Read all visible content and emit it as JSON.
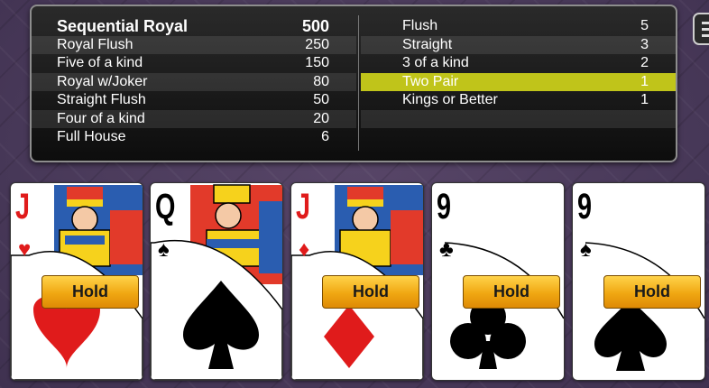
{
  "paytable": {
    "left": [
      {
        "name": "Sequential Royal",
        "pay": "500",
        "header": true
      },
      {
        "name": "Royal Flush",
        "pay": "250"
      },
      {
        "name": "Five of a kind",
        "pay": "150"
      },
      {
        "name": "Royal w/Joker",
        "pay": "80"
      },
      {
        "name": "Straight Flush",
        "pay": "50"
      },
      {
        "name": "Four of a kind",
        "pay": "20"
      },
      {
        "name": "Full House",
        "pay": "6"
      }
    ],
    "right": [
      {
        "name": "Flush",
        "pay": "5"
      },
      {
        "name": "Straight",
        "pay": "3"
      },
      {
        "name": "3 of a kind",
        "pay": "2"
      },
      {
        "name": "Two Pair",
        "pay": "1",
        "highlight": true
      },
      {
        "name": "Kings or Better",
        "pay": "1"
      }
    ],
    "highlight_color": "#c0c41a"
  },
  "menu_button": {
    "icon": "hamburger-menu-icon"
  },
  "cards": [
    {
      "rank": "J",
      "suit": "hearts",
      "suit_glyph": "♥",
      "color": "red",
      "face": true,
      "hold_label": "Hold",
      "held": true
    },
    {
      "rank": "Q",
      "suit": "spades",
      "suit_glyph": "♠",
      "color": "black",
      "face": true,
      "hold_label": "",
      "held": false
    },
    {
      "rank": "J",
      "suit": "diamonds",
      "suit_glyph": "♦",
      "color": "red",
      "face": true,
      "hold_label": "Hold",
      "held": true
    },
    {
      "rank": "9",
      "suit": "clubs",
      "suit_glyph": "♣",
      "color": "black",
      "face": false,
      "hold_label": "Hold",
      "held": true
    },
    {
      "rank": "9",
      "suit": "spades",
      "suit_glyph": "♠",
      "color": "black",
      "face": false,
      "hold_label": "Hold",
      "held": true
    }
  ],
  "colors": {
    "card_red": "#e01b1b",
    "hold_orange": "#f0a712"
  }
}
